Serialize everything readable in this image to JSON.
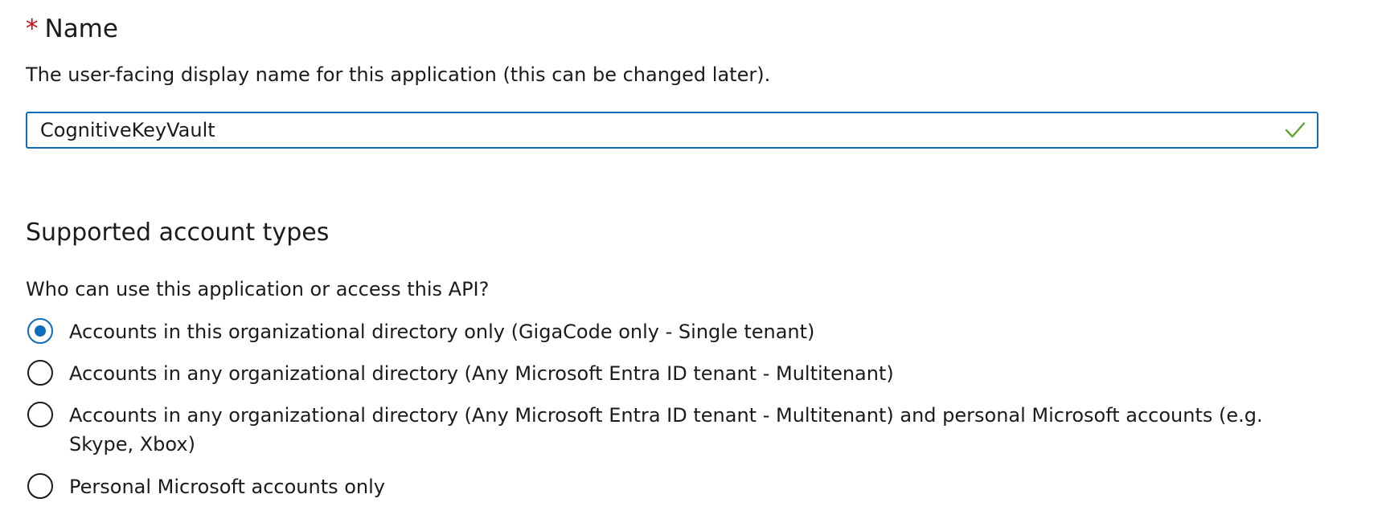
{
  "name_field": {
    "required_marker": "*",
    "label": "Name",
    "description": "The user-facing display name for this application (this can be changed later).",
    "value": "CognitiveKeyVault",
    "valid": true,
    "valid_icon": "checkmark-icon",
    "valid_color": "#5ea834",
    "focus_color": "#0f6cbd"
  },
  "account_types": {
    "heading": "Supported account types",
    "question": "Who can use this application or access this API?",
    "options": [
      {
        "label": "Accounts in this organizational directory only (GigaCode only - Single tenant)",
        "selected": true
      },
      {
        "label": "Accounts in any organizational directory (Any Microsoft Entra ID tenant - Multitenant)",
        "selected": false
      },
      {
        "label": "Accounts in any organizational directory (Any Microsoft Entra ID tenant - Multitenant) and personal Microsoft accounts (e.g. Skype, Xbox)",
        "selected": false
      },
      {
        "label": "Personal Microsoft accounts only",
        "selected": false
      }
    ]
  }
}
